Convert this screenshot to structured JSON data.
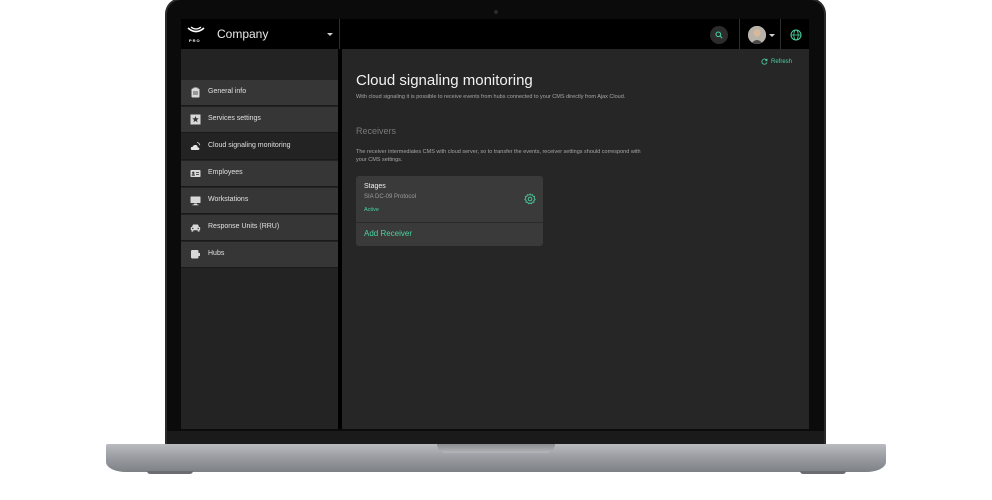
{
  "header": {
    "logo_sub": "PRO",
    "company": "Company"
  },
  "sidebar": {
    "items": [
      {
        "label": "General info",
        "icon": "clipboard-icon",
        "active": false
      },
      {
        "label": "Services settings",
        "icon": "star-icon",
        "active": false
      },
      {
        "label": "Cloud signaling monitoring",
        "icon": "cloud-icon",
        "active": true
      },
      {
        "label": "Employees",
        "icon": "id-card-icon",
        "active": false
      },
      {
        "label": "Workstations",
        "icon": "monitor-icon",
        "active": false
      },
      {
        "label": "Response Units (RRU)",
        "icon": "car-icon",
        "active": false
      },
      {
        "label": "Hubs",
        "icon": "hub-icon",
        "active": false
      }
    ]
  },
  "main": {
    "refresh_label": "Refresh",
    "title": "Cloud signaling monitoring",
    "description": "With cloud signaling it is possible to receive events from hubs connected to your CMS directly from Ajax Cloud.",
    "receivers_heading": "Receivers",
    "receivers_description": "The receiver intermediates CMS with cloud server, so to transfer the events, receiver settings should correspond with your CMS settings.",
    "receiver": {
      "name": "Stages",
      "protocol": "SIA DC-09 Protocol",
      "status": "Active"
    },
    "add_receiver_label": "Add Receiver"
  },
  "colors": {
    "accent": "#4bd3a0",
    "background": "#262626",
    "sidebar_item": "#363636"
  }
}
